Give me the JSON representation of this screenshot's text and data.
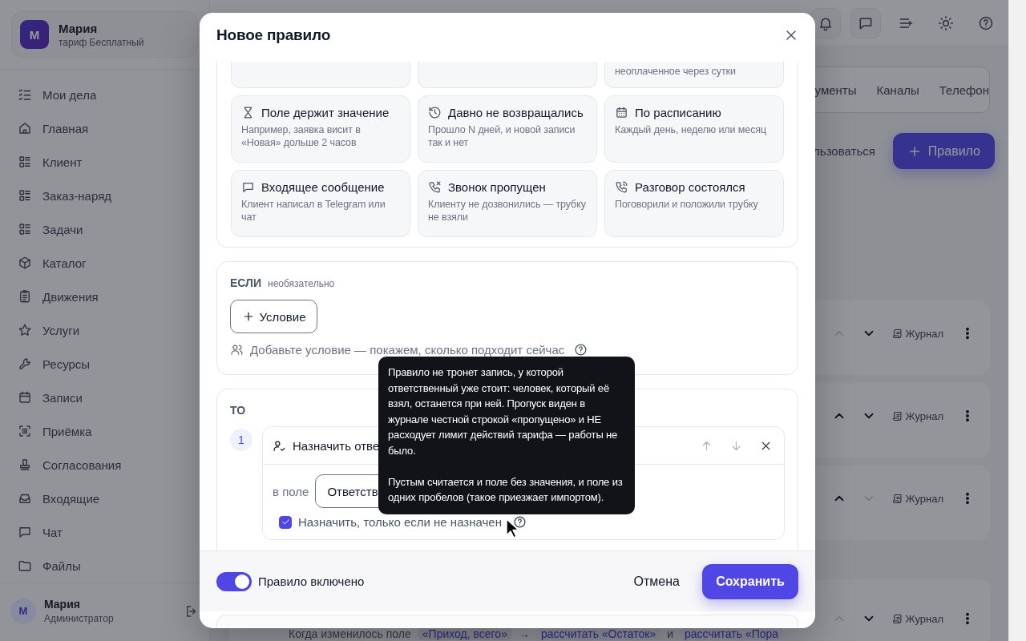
{
  "sidebar": {
    "profile": {
      "avatar": "М",
      "name": "Мария",
      "plan": "тариф Бесплатный"
    },
    "nav": [
      {
        "label": "Мои дела"
      },
      {
        "label": "Главная"
      },
      {
        "label": "Клиент"
      },
      {
        "label": "Заказ-наряд"
      },
      {
        "label": "Задачи"
      },
      {
        "label": "Каталог"
      },
      {
        "label": "Движения"
      },
      {
        "label": "Услуги"
      },
      {
        "label": "Ресурсы"
      },
      {
        "label": "Записи"
      },
      {
        "label": "Приёмка"
      },
      {
        "label": "Согласования"
      },
      {
        "label": "Входящие"
      },
      {
        "label": "Чат"
      },
      {
        "label": "Файлы"
      }
    ],
    "user": {
      "avatar": "М",
      "name": "Мария",
      "role": "Администратор"
    }
  },
  "tabs": [
    {
      "label": "ументы",
      "selected": false
    },
    {
      "label": "Каналы",
      "selected": false
    },
    {
      "label": "Телефон",
      "selected": false
    }
  ],
  "toolbar": {
    "text": "льзоваться",
    "button": "Правило"
  },
  "rules": [
    {
      "up_disabled": true,
      "down_disabled": false,
      "journal": "Журнал"
    },
    {
      "up_disabled": false,
      "down_disabled": false,
      "journal": "Журнал"
    },
    {
      "up_disabled": false,
      "down_disabled": true,
      "journal": "Журнал"
    },
    {
      "up_disabled": true,
      "down_disabled": false,
      "journal": "Журнал",
      "summary": [
        {
          "kind": "text",
          "text": "Когда изменилось поле"
        },
        {
          "kind": "field",
          "text": "«Приход, всего»"
        },
        {
          "kind": "text",
          "text": "→"
        },
        {
          "kind": "action",
          "text": "рассчитать «Остаток»"
        },
        {
          "kind": "text",
          "text": "и"
        },
        {
          "kind": "action",
          "text": "рассчитать «Пора"
        }
      ]
    }
  ],
  "modal": {
    "title": "Новое правило",
    "triggers": [
      {
        "kind": "cut",
        "selected": false
      },
      {
        "kind": "cut",
        "selected": false
      },
      {
        "kind": "cut",
        "selected": false,
        "description": "неоплаченное через сутки"
      },
      {
        "kind": "full",
        "selected": false,
        "title": "Поле держит значение",
        "description": "Например, заявка висит в «Новая» дольше 2 часов"
      },
      {
        "kind": "full",
        "selected": false,
        "title": "Давно не возвращались",
        "description": "Прошло N дней, и новой записи так и нет"
      },
      {
        "kind": "full",
        "selected": false,
        "title": "По расписанию",
        "description": "Каждый день, неделю или месяц"
      },
      {
        "kind": "full",
        "selected": false,
        "title": "Входящее сообщение",
        "description": "Клиент написал в Telegram или чат"
      },
      {
        "kind": "full",
        "selected": false,
        "title": "Звонок пропущен",
        "description": "Клиенту не дозвонились — трубку не взяли"
      },
      {
        "kind": "full",
        "selected": false,
        "title": "Разговор состоялся",
        "description": "Поговорили и положили трубку"
      }
    ],
    "condition_section": {
      "label": "ЕСЛИ",
      "hint": "необязательно",
      "add_button": "Условие",
      "preview": "Добавьте условие — покажем, сколько подходит сейчас"
    },
    "action_section": {
      "label": "ТО",
      "steps": [
        {
          "number": "1",
          "title": "Назначить отве",
          "field_label": "в поле",
          "field_value": "Ответств",
          "only_if_unassigned": {
            "label": "Назначить, только если не назначен",
            "checked": true
          }
        }
      ]
    },
    "tooltip": {
      "paragraphs": [
        "Правило не тронет запись, у которой ответственный уже стоит: человек, который её взял, останется при ней. Пропуск виден в журнале честной строкой «пропущено» и НЕ расходует лимит действий тарифа — работы не было.",
        "Пустым считается и поле без значения, и поле из одних пробелов (такое приезжает импортом)."
      ]
    },
    "footer": {
      "enabled": {
        "label": "Правило включено",
        "on": true
      },
      "cancel": "Отмена",
      "save": "Сохранить"
    }
  }
}
